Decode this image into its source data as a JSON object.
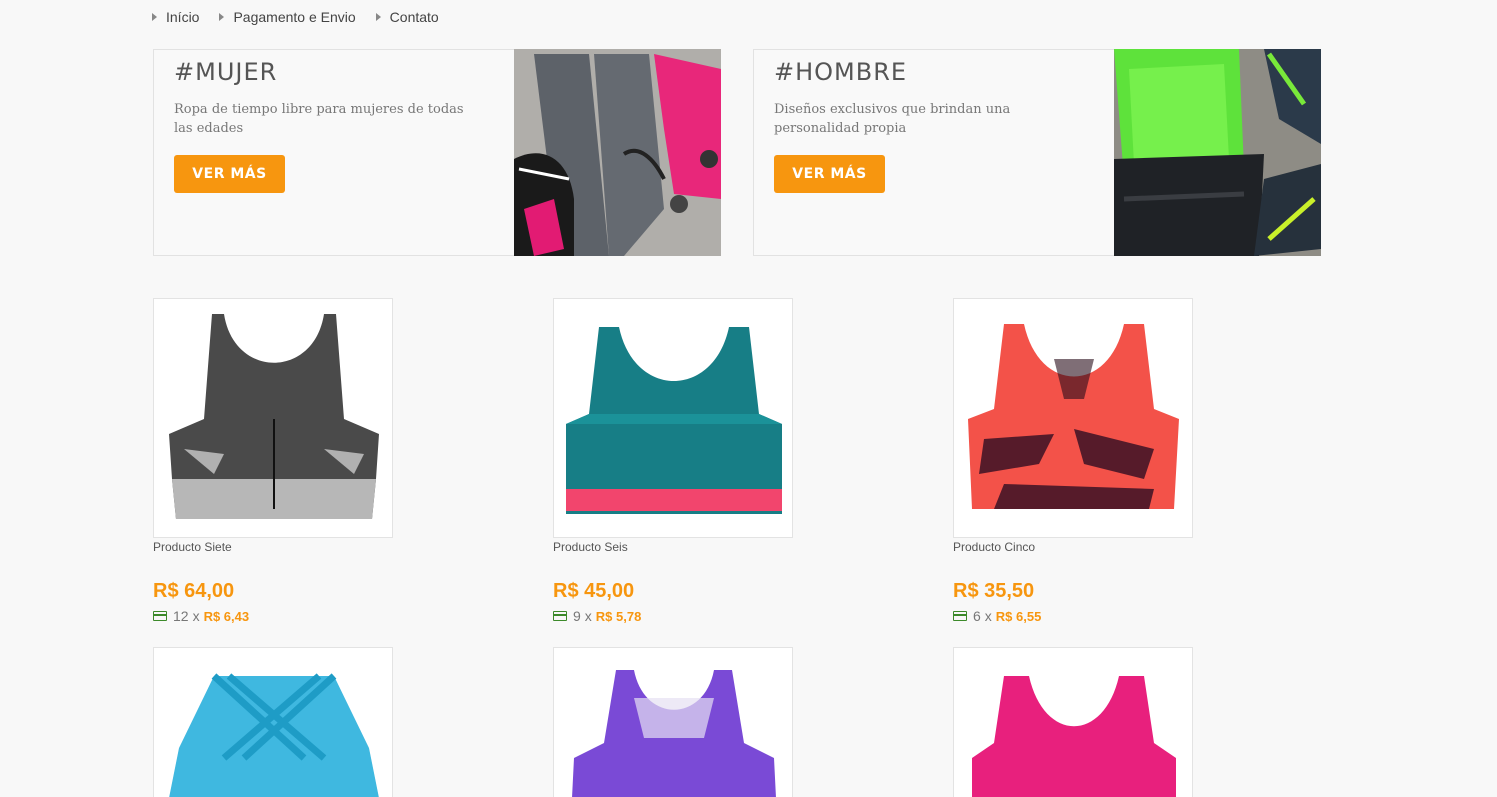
{
  "nav": {
    "items": [
      "Início",
      "Pagamento e Envio",
      "Contato"
    ]
  },
  "banners": [
    {
      "title": "#MUJER",
      "description": "Ropa de tiempo libre para mujeres de todas las edades",
      "button": "VER MÁS"
    },
    {
      "title": "#HOMBRE",
      "description": "Diseños exclusivos que brindan una personalidad propia",
      "button": "VER MÁS"
    }
  ],
  "products": [
    {
      "name": "Producto Siete",
      "price": "R$ 64,00",
      "installments": "12",
      "installment_sep": "x",
      "installment_value": "R$ 6,43",
      "color": "#6b6b6b"
    },
    {
      "name": "Producto Seis",
      "price": "R$ 45,00",
      "installments": "9",
      "installment_sep": "x",
      "installment_value": "R$ 5,78",
      "color": "#1a8c8e"
    },
    {
      "name": "Producto Cinco",
      "price": "R$ 35,50",
      "installments": "6",
      "installment_sep": "x",
      "installment_value": "R$ 6,55",
      "color": "#f0504a"
    },
    {
      "color": "#2fb1d8"
    },
    {
      "color": "#7c4ad6"
    },
    {
      "color": "#e8207d"
    }
  ],
  "colors": {
    "accent": "#f7960f",
    "card_icon": "#3c8a2a"
  }
}
